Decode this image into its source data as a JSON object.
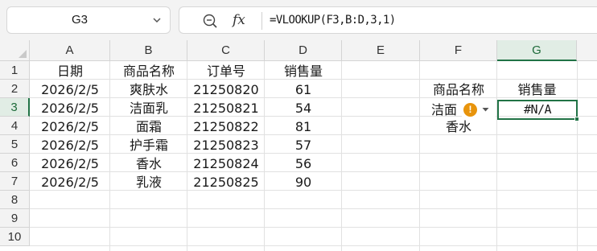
{
  "name_box": {
    "value": "G3"
  },
  "formula_bar": {
    "formula": "=VLOOKUP(F3,B:D,3,1)",
    "fx_label": "fx"
  },
  "columns": [
    "A",
    "B",
    "C",
    "D",
    "E",
    "F",
    "G"
  ],
  "rows": [
    "1",
    "2",
    "3",
    "4",
    "5",
    "6",
    "7",
    "8",
    "9",
    "10"
  ],
  "selected": {
    "column": "G",
    "row": "3"
  },
  "table": {
    "headers": [
      "日期",
      "商品名称",
      "订单号",
      "销售量"
    ],
    "rows": [
      [
        "2026/2/5",
        "爽肤水",
        "21250820",
        "61"
      ],
      [
        "2026/2/5",
        "洁面乳",
        "21250821",
        "54"
      ],
      [
        "2026/2/5",
        "面霜",
        "21250822",
        "81"
      ],
      [
        "2026/2/5",
        "护手霜",
        "21250823",
        "57"
      ],
      [
        "2026/2/5",
        "香水",
        "21250824",
        "56"
      ],
      [
        "2026/2/5",
        "乳液",
        "21250825",
        "90"
      ]
    ]
  },
  "lookup": {
    "header_name": "商品名称",
    "header_sales": "销售量",
    "f3_visible": "洁面",
    "f4": "香水",
    "g3": "#N/A",
    "error_icon": "!"
  },
  "colors": {
    "accent": "#217346",
    "warning": "#e8940c"
  }
}
